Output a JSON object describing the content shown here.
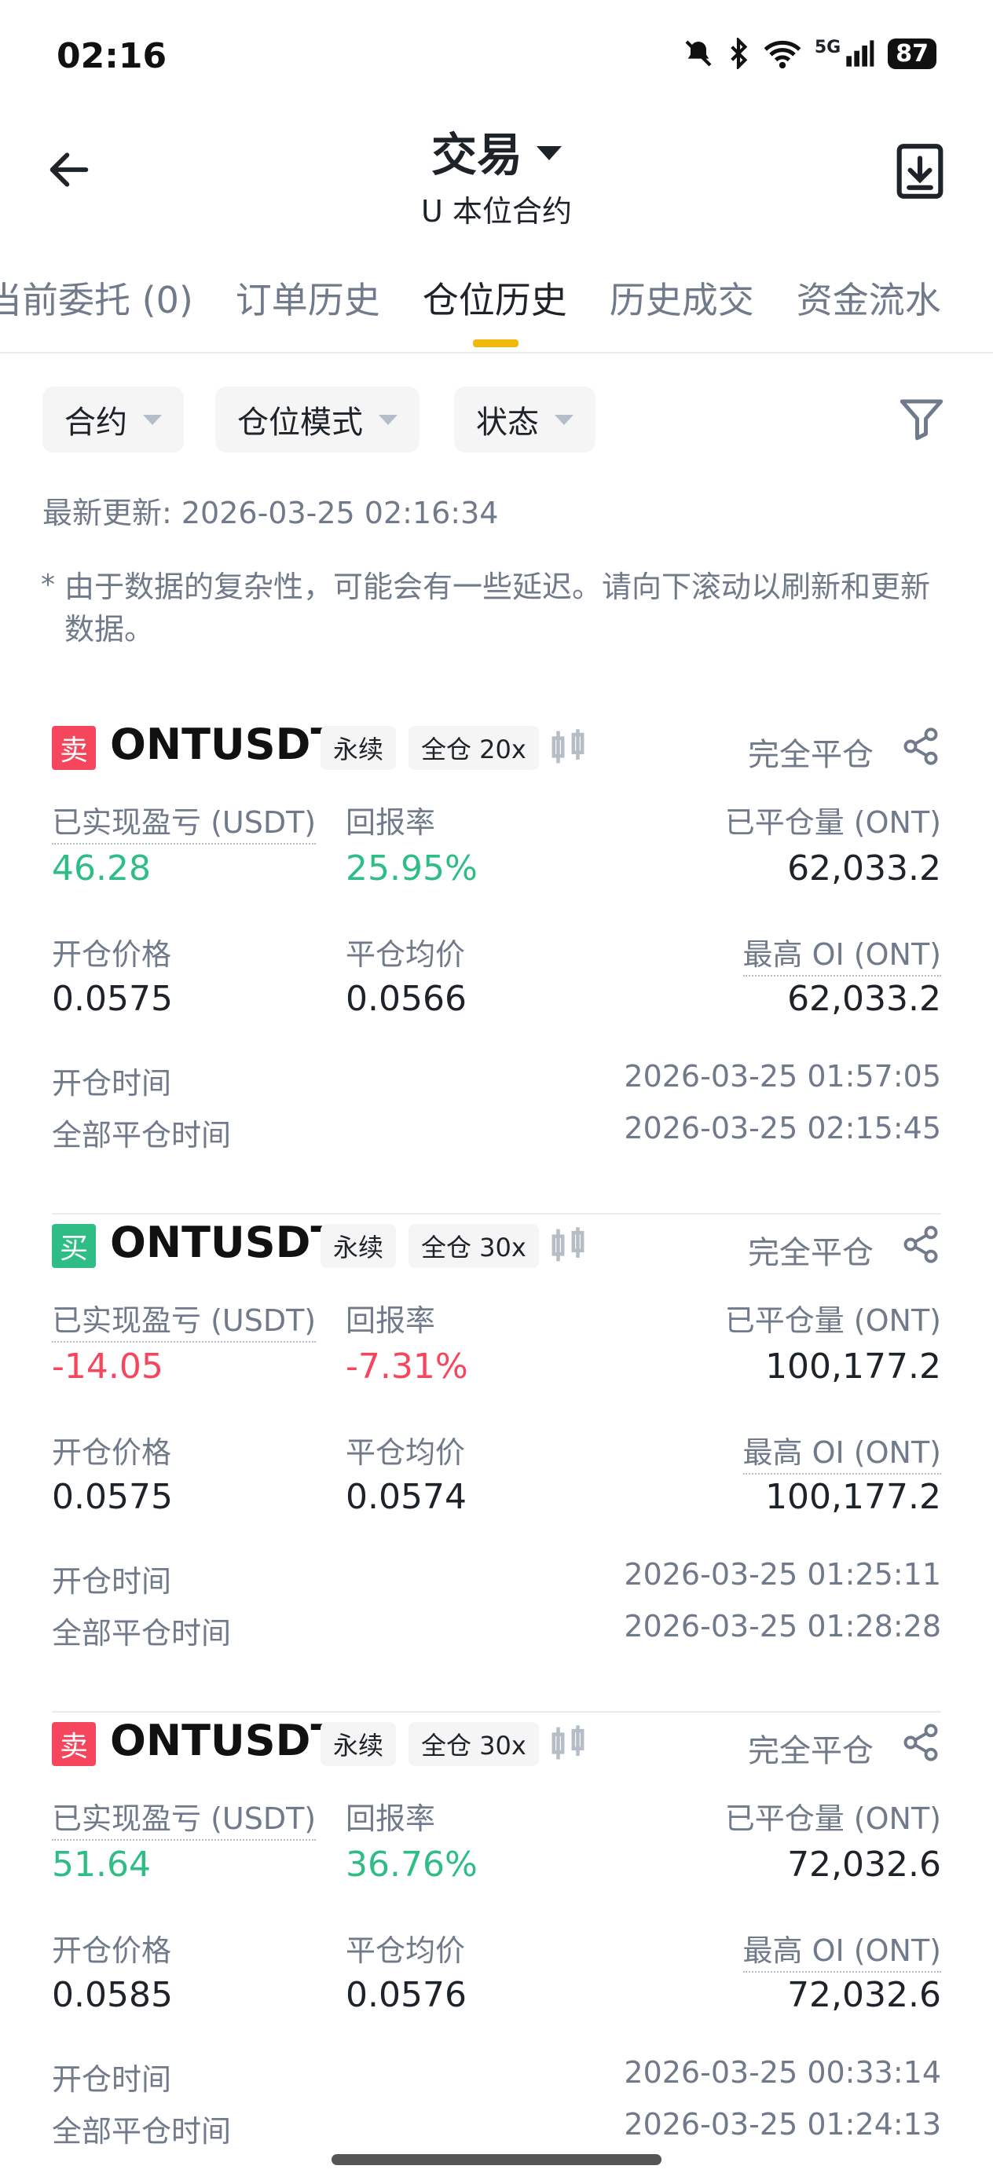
{
  "status_bar": {
    "time": "02:16",
    "network": "5G",
    "battery": "87"
  },
  "header": {
    "title": "交易",
    "subtitle": "U 本位合约"
  },
  "tabs": [
    {
      "label": "当前委托 (0)"
    },
    {
      "label": "订单历史"
    },
    {
      "label": "仓位历史",
      "active": true
    },
    {
      "label": "历史成交"
    },
    {
      "label": "资金流水"
    }
  ],
  "filters": [
    {
      "label": "合约"
    },
    {
      "label": "仓位模式"
    },
    {
      "label": "状态"
    }
  ],
  "update_line": "最新更新: 2026-03-25 02:16:34",
  "note": {
    "star": "*",
    "text": "由于数据的复杂性，可能会有一些延迟。请向下滚动以刷新和更新数据。"
  },
  "labels": {
    "realized_pnl": "已实现盈亏 (USDT)",
    "roi": "回报率",
    "closed_qty": "已平仓量 (ONT)",
    "entry_price": "开仓价格",
    "avg_close_price": "平仓均价",
    "max_oi": "最高 OI (ONT)",
    "open_time": "开仓时间",
    "close_time": "全部平仓时间"
  },
  "positions": [
    {
      "side": "卖",
      "side_type": "sell",
      "symbol": "ONTUSDT",
      "contract": "永续",
      "margin": "全仓 20x",
      "status": "完全平仓",
      "pnl": "46.28",
      "roi": "25.95%",
      "closed_qty": "62,033.2",
      "entry_price": "0.0575",
      "avg_close": "0.0566",
      "max_oi": "62,033.2",
      "open_time": "2026-03-25 01:57:05",
      "close_time": "2026-03-25 02:15:45"
    },
    {
      "side": "买",
      "side_type": "buy",
      "symbol": "ONTUSDT",
      "contract": "永续",
      "margin": "全仓 30x",
      "status": "完全平仓",
      "pnl": "-14.05",
      "roi": "-7.31%",
      "closed_qty": "100,177.2",
      "entry_price": "0.0575",
      "avg_close": "0.0574",
      "max_oi": "100,177.2",
      "open_time": "2026-03-25 01:25:11",
      "close_time": "2026-03-25 01:28:28"
    },
    {
      "side": "卖",
      "side_type": "sell",
      "symbol": "ONTUSDT",
      "contract": "永续",
      "margin": "全仓 30x",
      "status": "完全平仓",
      "pnl": "51.64",
      "roi": "36.76%",
      "closed_qty": "72,032.6",
      "entry_price": "0.0585",
      "avg_close": "0.0576",
      "max_oi": "72,032.6",
      "open_time": "2026-03-25 00:33:14",
      "close_time": "2026-03-25 01:24:13"
    }
  ],
  "colors": {
    "accent": "#f0b90b",
    "positive": "#2ebd85",
    "negative": "#f6465d"
  },
  "icons": [
    "back-arrow-icon",
    "download-icon",
    "filter-icon",
    "kline-icon",
    "share-icon",
    "mute-bell-icon",
    "bluetooth-icon",
    "wifi-icon",
    "signal-icon"
  ]
}
